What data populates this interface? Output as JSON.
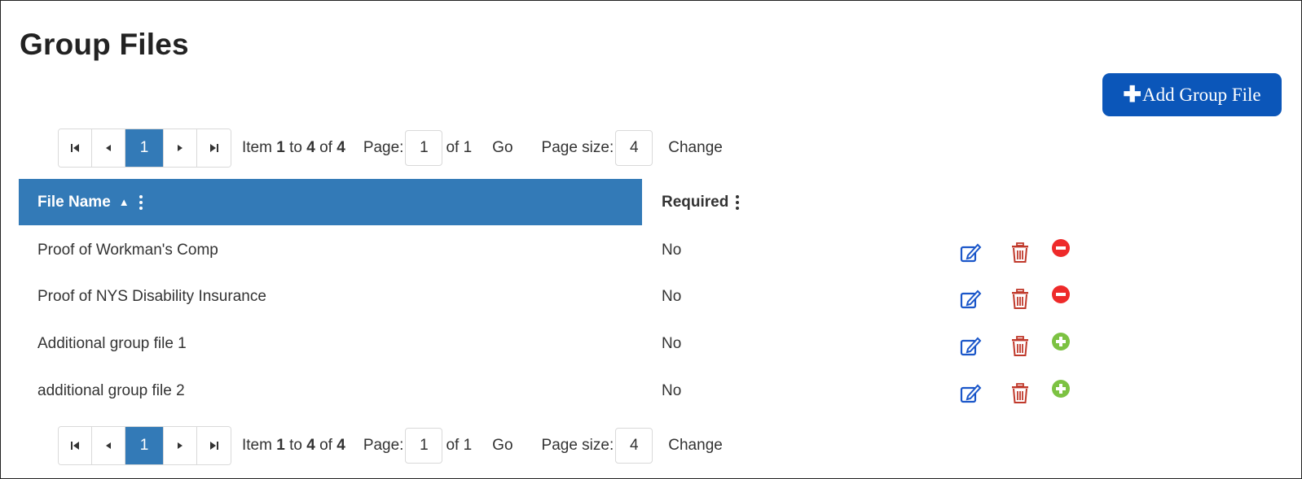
{
  "page": {
    "title": "Group Files",
    "add_button": "Add Group File"
  },
  "pager_top": {
    "current_page": "1",
    "item_prefix": "Item",
    "item_from": "1",
    "item_to_word": "to",
    "item_to": "4",
    "item_of_word": "of",
    "item_total": "4",
    "page_label": "Page:",
    "page_value": "1",
    "page_of": "of 1",
    "go_label": "Go",
    "page_size_label": "Page size:",
    "page_size_value": "4",
    "change_label": "Change"
  },
  "pager_bottom": {
    "current_page": "1",
    "item_prefix": "Item",
    "item_from": "1",
    "item_to_word": "to",
    "item_to": "4",
    "item_of_word": "of",
    "item_total": "4",
    "page_label": "Page:",
    "page_value": "1",
    "page_of": "of 1",
    "go_label": "Go",
    "page_size_label": "Page size:",
    "page_size_value": "4",
    "change_label": "Change"
  },
  "table": {
    "columns": {
      "file_name": "File Name",
      "required": "Required"
    },
    "rows": [
      {
        "file_name": "Proof of Workman's Comp",
        "required": "No",
        "toggle": "remove-circle-icon"
      },
      {
        "file_name": "Proof of NYS Disability Insurance",
        "required": "No",
        "toggle": "remove-circle-icon"
      },
      {
        "file_name": "Additional group file 1",
        "required": "No",
        "toggle": "add-circle-icon"
      },
      {
        "file_name": "additional group file 2",
        "required": "No",
        "toggle": "add-circle-icon"
      }
    ]
  },
  "colors": {
    "primary_button": "#0b56b9",
    "header_blue": "#337ab7",
    "edit_icon": "#1a56c9",
    "delete_icon": "#c0392b",
    "remove_icon": "#ee2a2a",
    "add_icon": "#7cc242"
  }
}
